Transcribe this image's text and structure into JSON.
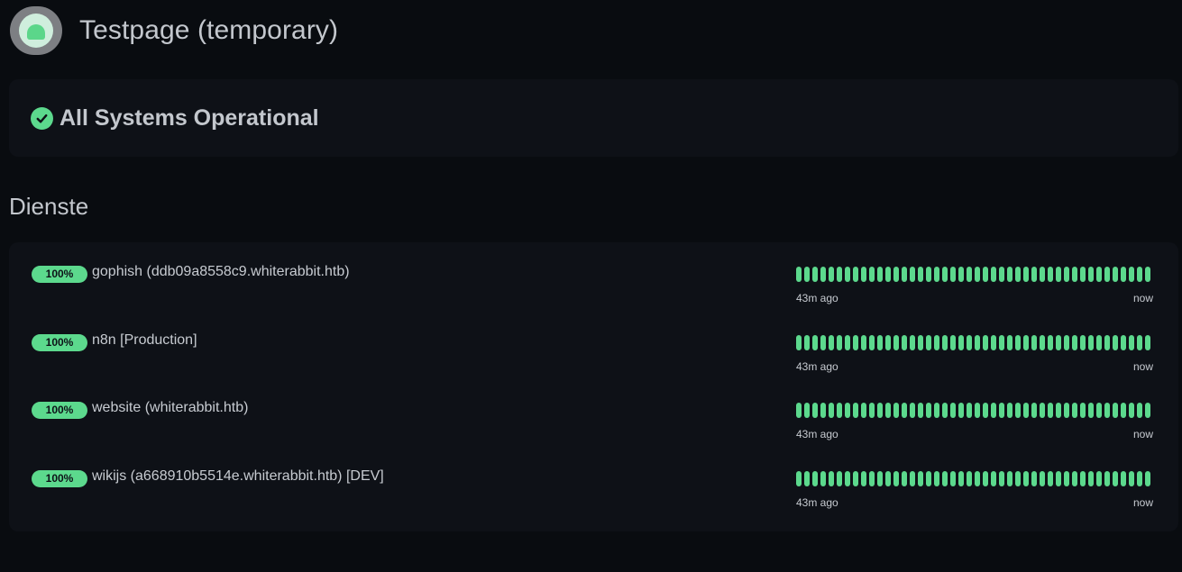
{
  "header": {
    "title": "Testpage (temporary)",
    "logo_icon": "uptime-kuma-logo-icon"
  },
  "status": {
    "text": "All Systems Operational",
    "icon": "check-circle-icon",
    "color": "#5cd98d"
  },
  "section": {
    "title": "Dienste"
  },
  "services": [
    {
      "uptime": "100%",
      "name": "gophish (ddb09a8558c9.whiterabbit.htb)",
      "beat_count": 44,
      "from_label": "43m ago",
      "to_label": "now"
    },
    {
      "uptime": "100%",
      "name": "n8n [Production]",
      "beat_count": 44,
      "from_label": "43m ago",
      "to_label": "now"
    },
    {
      "uptime": "100%",
      "name": "website (whiterabbit.htb)",
      "beat_count": 44,
      "from_label": "43m ago",
      "to_label": "now"
    },
    {
      "uptime": "100%",
      "name": "wikijs (a668910b5514e.whiterabbit.htb) [DEV]",
      "beat_count": 44,
      "from_label": "43m ago",
      "to_label": "now"
    }
  ],
  "colors": {
    "background": "#090c10",
    "card": "#0e1117",
    "up": "#5cd98d"
  }
}
